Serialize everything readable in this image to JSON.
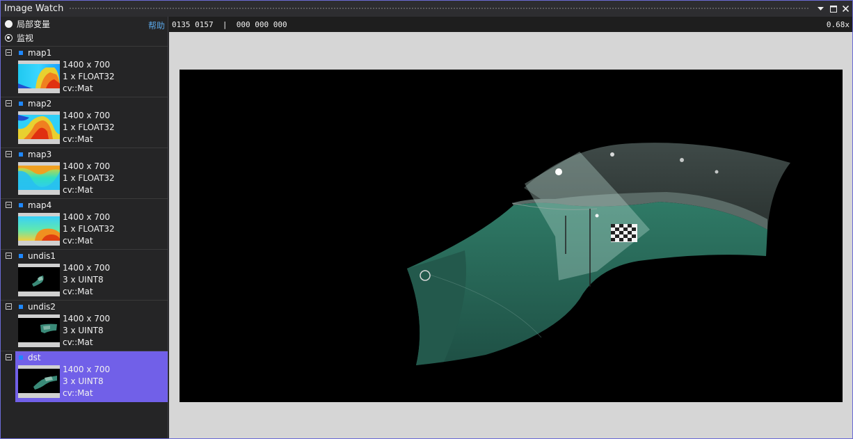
{
  "window": {
    "title": "Image Watch"
  },
  "titlebar": {
    "dropdown_icon": "chevron-down-icon",
    "maximize_icon": "maximize-icon",
    "close_icon": "close-icon"
  },
  "mode": {
    "locals_label": "局部变量",
    "watch_label": "监视",
    "selected": "watch"
  },
  "help_label": "帮助",
  "status": {
    "pixel_readout": "0135 0157  |  000 000 000",
    "zoom": "0.68x"
  },
  "items": [
    {
      "name": "map1",
      "size": "1400 x 700",
      "type": "1 x FLOAT32",
      "class": "cv::Mat",
      "selected": false
    },
    {
      "name": "map2",
      "size": "1400 x 700",
      "type": "1 x FLOAT32",
      "class": "cv::Mat",
      "selected": false
    },
    {
      "name": "map3",
      "size": "1400 x 700",
      "type": "1 x FLOAT32",
      "class": "cv::Mat",
      "selected": false
    },
    {
      "name": "map4",
      "size": "1400 x 700",
      "type": "1 x FLOAT32",
      "class": "cv::Mat",
      "selected": false
    },
    {
      "name": "undis1",
      "size": "1400 x 700",
      "type": "3 x UINT8",
      "class": "cv::Mat",
      "selected": false
    },
    {
      "name": "undis2",
      "size": "1400 x 700",
      "type": "3 x UINT8",
      "class": "cv::Mat",
      "selected": false
    },
    {
      "name": "dst",
      "size": "1400 x 700",
      "type": "3 x UINT8",
      "class": "cv::Mat",
      "selected": true
    }
  ],
  "colors": {
    "accent": "#7160e8",
    "link": "#5aa6e6",
    "marker": "#1e88ff",
    "floor": "#2f6f5f"
  }
}
